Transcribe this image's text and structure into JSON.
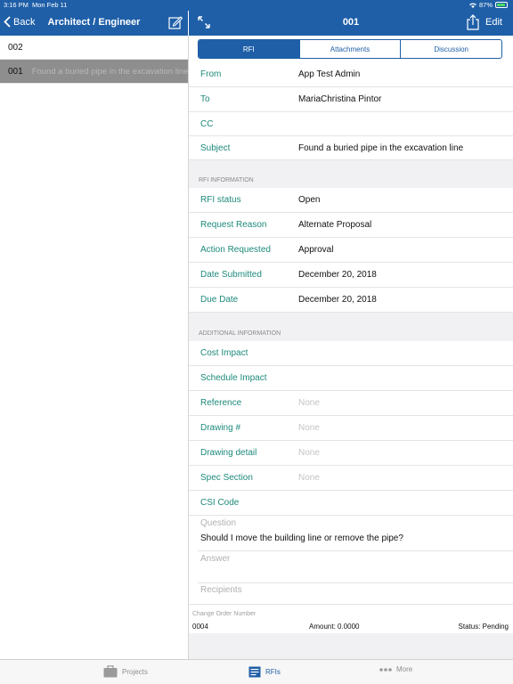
{
  "status_bar": {
    "time": "3:16 PM",
    "date": "Mon Feb 11",
    "battery": "87%"
  },
  "left_nav": {
    "back_label": "Back",
    "title": "Architect / Engineer"
  },
  "right_nav": {
    "title": "001",
    "edit_label": "Edit"
  },
  "left_list": {
    "items": [
      {
        "number": "002",
        "subject": ""
      },
      {
        "number": "001",
        "subject": "Found a buried pipe in the excavation line",
        "selected": true
      }
    ]
  },
  "tabs": [
    "RFI",
    "Attachments",
    "Discussion"
  ],
  "header_fields": [
    {
      "label": "From",
      "value": "App Test Admin"
    },
    {
      "label": "To",
      "value": "MariaChristina Pintor"
    },
    {
      "label": "CC",
      "value": ""
    },
    {
      "label": "Subject",
      "value": "Found a buried pipe in the excavation line"
    }
  ],
  "rfi_section_title": "RFI INFORMATION",
  "rfi_fields": [
    {
      "label": "RFI status",
      "value": "Open"
    },
    {
      "label": "Request Reason",
      "value": "Alternate Proposal"
    },
    {
      "label": "Action Requested",
      "value": "Approval"
    },
    {
      "label": "Date Submitted",
      "value": "December 20, 2018"
    },
    {
      "label": "Due Date",
      "value": "December 20, 2018"
    }
  ],
  "additional_section_title": "ADDITIONAL INFORMATION",
  "additional_fields": [
    {
      "label": "Cost Impact",
      "value": ""
    },
    {
      "label": "Schedule Impact",
      "value": ""
    },
    {
      "label": "Reference",
      "value": "None"
    },
    {
      "label": "Drawing #",
      "value": "None"
    },
    {
      "label": "Drawing detail",
      "value": "None"
    },
    {
      "label": "Spec Section",
      "value": "None"
    },
    {
      "label": "CSI Code",
      "value": ""
    }
  ],
  "question": {
    "label": "Question",
    "value": "Should I move the building line or remove the pipe?"
  },
  "answer": {
    "label": "Answer"
  },
  "recipients": {
    "label": "Recipients"
  },
  "change_order": {
    "label": "Change Order Number",
    "number": "0004",
    "amount": "Amount: 0.0000",
    "status": "Status: Pending"
  },
  "tabbar": {
    "projects": "Projects",
    "rfis": "RFIs",
    "more": "More"
  },
  "colors": {
    "brand": "#1f5fa8",
    "label": "#1d8a7b"
  }
}
